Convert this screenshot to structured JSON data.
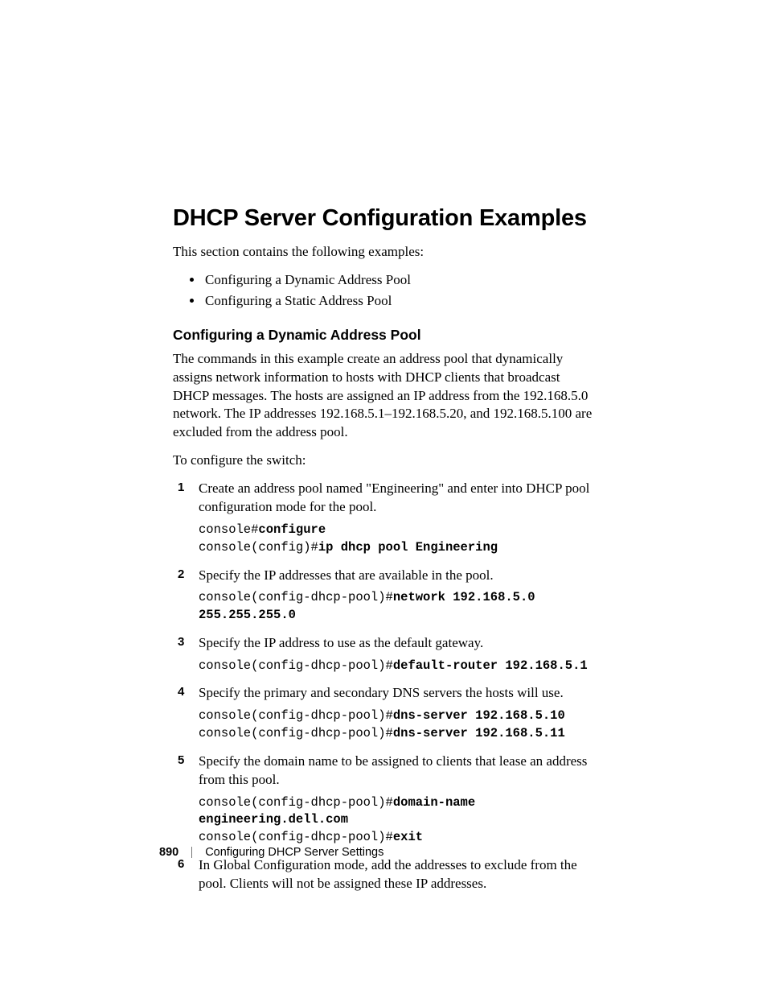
{
  "heading": "DHCP Server Configuration Examples",
  "intro": "This section contains the following examples:",
  "bullets": [
    "Configuring a Dynamic Address Pool",
    "Configuring a Static Address Pool"
  ],
  "subheading": "Configuring a Dynamic Address Pool",
  "para1": "The commands in this example create an address pool that dynamically assigns network information to hosts with DHCP clients that broadcast DHCP messages. The hosts are assigned an IP address from the 192.168.5.0 network. The IP addresses 192.168.5.1–192.168.5.20, and 192.168.5.100 are excluded from the address pool.",
  "para2": "To configure the switch:",
  "steps": [
    {
      "num": "1",
      "text": "Create an address pool named \"Engineering\" and enter into DHCP pool configuration mode for the pool.",
      "code": {
        "l1_prompt": "console#",
        "l1_cmd": "configure",
        "l2_prompt": "console(config)#",
        "l2_cmd": "ip dhcp pool Engineering"
      }
    },
    {
      "num": "2",
      "text": "Specify the IP addresses that are available in the pool.",
      "code": {
        "l1_prompt": "console(config-dhcp-pool)#",
        "l1_cmd": "network 192.168.5.0 255.255.255.0"
      }
    },
    {
      "num": "3",
      "text": "Specify the IP address to use as the default gateway.",
      "code": {
        "l1_prompt": "console(config-dhcp-pool)#",
        "l1_cmd": "default-router 192.168.5.1"
      }
    },
    {
      "num": "4",
      "text": "Specify the primary and secondary DNS servers the hosts will use.",
      "code": {
        "l1_prompt": "console(config-dhcp-pool)#",
        "l1_cmd": "dns-server 192.168.5.10",
        "l2_prompt": "console(config-dhcp-pool)#",
        "l2_cmd": "dns-server 192.168.5.11"
      }
    },
    {
      "num": "5",
      "text": "Specify the domain name to be assigned to clients that lease an address from this pool.",
      "code": {
        "l1_prompt": "console(config-dhcp-pool)#",
        "l1_cmd": "domain-name engineering.dell.com",
        "l2_prompt": "console(config-dhcp-pool)#",
        "l2_cmd": "exit"
      }
    },
    {
      "num": "6",
      "text": "In Global Configuration mode, add the addresses to exclude from the pool. Clients will not be assigned these IP addresses."
    }
  ],
  "footer": {
    "page": "890",
    "title": "Configuring DHCP Server Settings"
  }
}
